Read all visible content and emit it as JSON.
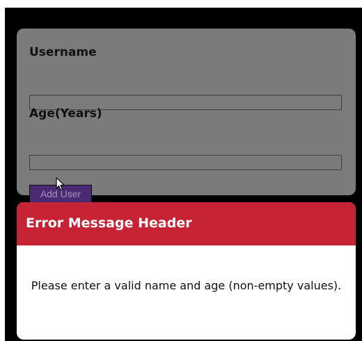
{
  "form": {
    "username_label": "Username",
    "username_value": "",
    "age_label": "Age(Years)",
    "age_value": "",
    "add_button_label": "Add User"
  },
  "error_modal": {
    "title": "Error Message Header",
    "message": "Please enter a valid name and age (non-empty values)."
  },
  "colors": {
    "backdrop": "#000000",
    "form_card": "#7b7b7b",
    "button": "#4a2a70",
    "modal_header": "#c62434",
    "modal_body": "#ffffff"
  }
}
